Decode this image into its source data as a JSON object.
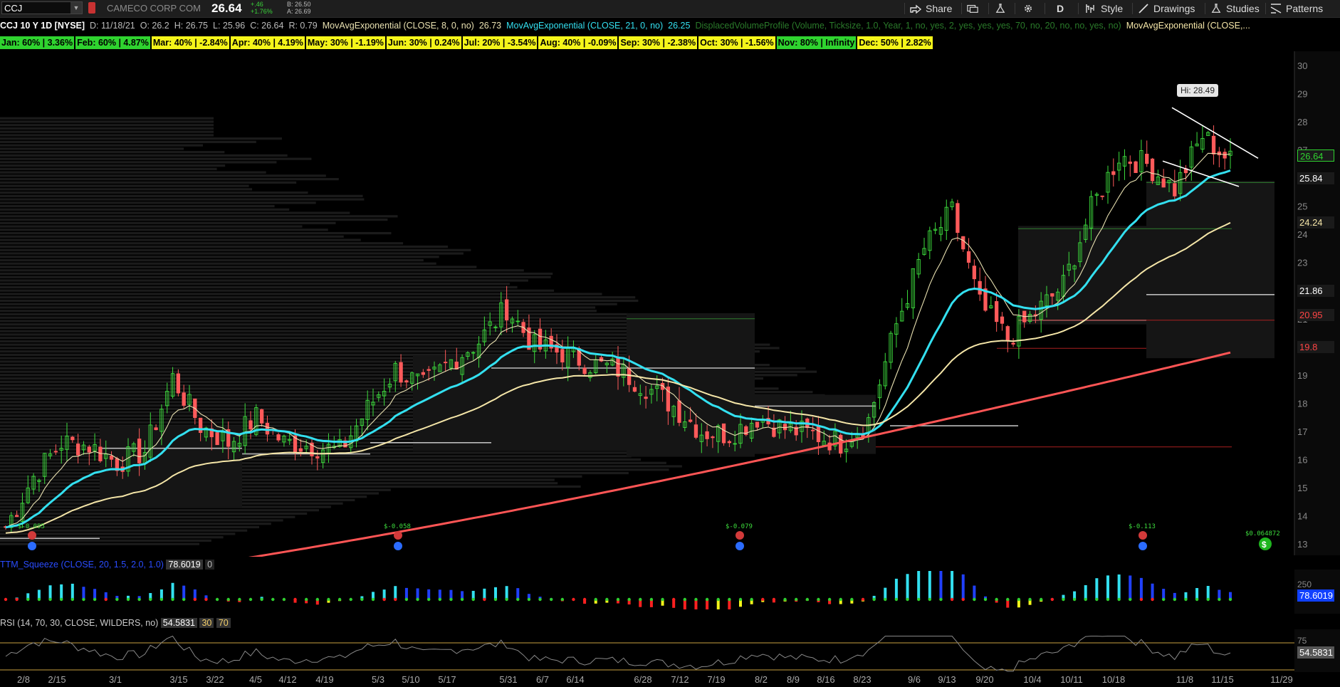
{
  "header": {
    "symbol": "CCJ",
    "company": "CAMECO CORP COM",
    "last": "26.64",
    "change": "+.46",
    "change_pct": "+1.76%",
    "bid": "B: 26.50",
    "ask": "A: 26.69"
  },
  "toolbar": {
    "share": "Share",
    "period": "D",
    "style": "Style",
    "drawings": "Drawings",
    "studies": "Studies",
    "patterns": "Patterns"
  },
  "studies": {
    "title": "CCJ 10 Y 1D [NYSE]",
    "date": "D: 11/18/21",
    "open": "O: 26.2",
    "high": "H: 26.75",
    "low": "L: 25.96",
    "close": "C: 26.64",
    "range": "R: 0.79",
    "ema8_label": "MovAvgExponential (CLOSE, 8, 0, no)",
    "ema8_value": "26.73",
    "ema21_label": "MovAvgExponential (CLOSE, 21, 0, no)",
    "ema21_value": "26.25",
    "dvp_label": "DisplacedVolumeProfile (Volume, Ticksize, 1.0, Year, 1, no, yes, 2, yes, yes, yes, 70, no, 20, no, no, yes, no)",
    "ema_last_label": "MovAvgExponential (CLOSE,..."
  },
  "seasonality": [
    {
      "label": "Jan: 60% | 3.36%",
      "color": "#2fd32f"
    },
    {
      "label": "Feb: 60% | 4.87%",
      "color": "#2fd32f"
    },
    {
      "label": "Mar: 40% | -2.84%",
      "color": "#f5f51a"
    },
    {
      "label": "Apr: 40% | 4.19%",
      "color": "#f5f51a"
    },
    {
      "label": "May: 30% | -1.19%",
      "color": "#f5f51a"
    },
    {
      "label": "Jun: 30% | 0.24%",
      "color": "#f5f51a"
    },
    {
      "label": "Jul: 20% | -3.54%",
      "color": "#f5f51a"
    },
    {
      "label": "Aug: 40% | -0.09%",
      "color": "#f5f51a"
    },
    {
      "label": "Sep: 30% | -2.38%",
      "color": "#f5f51a"
    },
    {
      "label": "Oct: 30% | -1.56%",
      "color": "#f5f51a"
    },
    {
      "label": "Nov: 80% | Infinity",
      "color": "#2fd32f"
    },
    {
      "label": "Dec: 50% | 2.82%",
      "color": "#f5f51a"
    }
  ],
  "price_tags": {
    "last": "26.64",
    "ema21": "25.84",
    "ema50": "24.24",
    "level1": "21.86",
    "level2": "20.95",
    "ema200": "19.8"
  },
  "annotations": {
    "high_bubble": "Hi: 28.49",
    "dividends": [
      "$-0.095",
      "$-0.058",
      "$-0.079",
      "$-0.113"
    ],
    "dividend_next": "$0.064872"
  },
  "squeeze": {
    "label": "TTM_Squeeze (CLOSE, 20, 1.5, 2.0, 1.0)",
    "value": "78.6019",
    "zero": "0",
    "axis_label": "250",
    "tag": "78.6019"
  },
  "rsi": {
    "label": "RSI (14, 70, 30, CLOSE, WILDERS, no)",
    "value": "54.5831",
    "os": "30",
    "ob": "70",
    "axis_label": "75",
    "tag": "54.5831"
  },
  "chart_data": {
    "type": "candlestick",
    "ylim": [
      12.6,
      31.2
    ],
    "yticks": [
      13,
      14,
      15,
      16,
      17,
      18,
      19,
      20,
      21,
      22,
      23,
      24,
      25,
      26,
      27,
      28,
      29,
      30,
      31
    ],
    "xtick_labels": [
      "2/8",
      "2/15",
      "3/1",
      "3/15",
      "3/22",
      "4/5",
      "4/12",
      "4/19",
      "5/3",
      "5/10",
      "5/17",
      "5/31",
      "6/7",
      "6/14",
      "6/28",
      "7/12",
      "7/19",
      "8/2",
      "8/9",
      "8/16",
      "8/23",
      "9/6",
      "9/13",
      "9/20",
      "10/4",
      "10/11",
      "10/18",
      "11/8",
      "11/15",
      "11/29"
    ],
    "weekly_closes": [
      13.6,
      15.4,
      16.6,
      16.5,
      15.9,
      16.3,
      18.9,
      17.2,
      16.6,
      17.5,
      16.6,
      16.5,
      16.3,
      17.8,
      19.2,
      18.6,
      19.5,
      20.2,
      21.4,
      20.0,
      19.8,
      19.4,
      19.2,
      18.6,
      17.9,
      17.0,
      16.9,
      17.5,
      17.1,
      16.9,
      16.6,
      17.4,
      20.8,
      23.5,
      24.8,
      21.5,
      20.3,
      21.2,
      22.2,
      24.9,
      26.8,
      26.5,
      25.6,
      27.5,
      26.6
    ],
    "series": [
      {
        "name": "MovAvgExponential (CLOSE, 8, 0, no)",
        "last": 26.73,
        "color": "#e8e0b0"
      },
      {
        "name": "MovAvgExponential (CLOSE, 21, 0, no)",
        "last": 26.25,
        "color": "#33e0f0"
      },
      {
        "name": "MovAvgExponential (CLOSE, ...)",
        "last": 24.24,
        "color": "#f5e6a8"
      },
      {
        "name": "MovAvgExponential (CLOSE, ...)",
        "last": 19.8,
        "color": "#ff5555"
      }
    ]
  }
}
